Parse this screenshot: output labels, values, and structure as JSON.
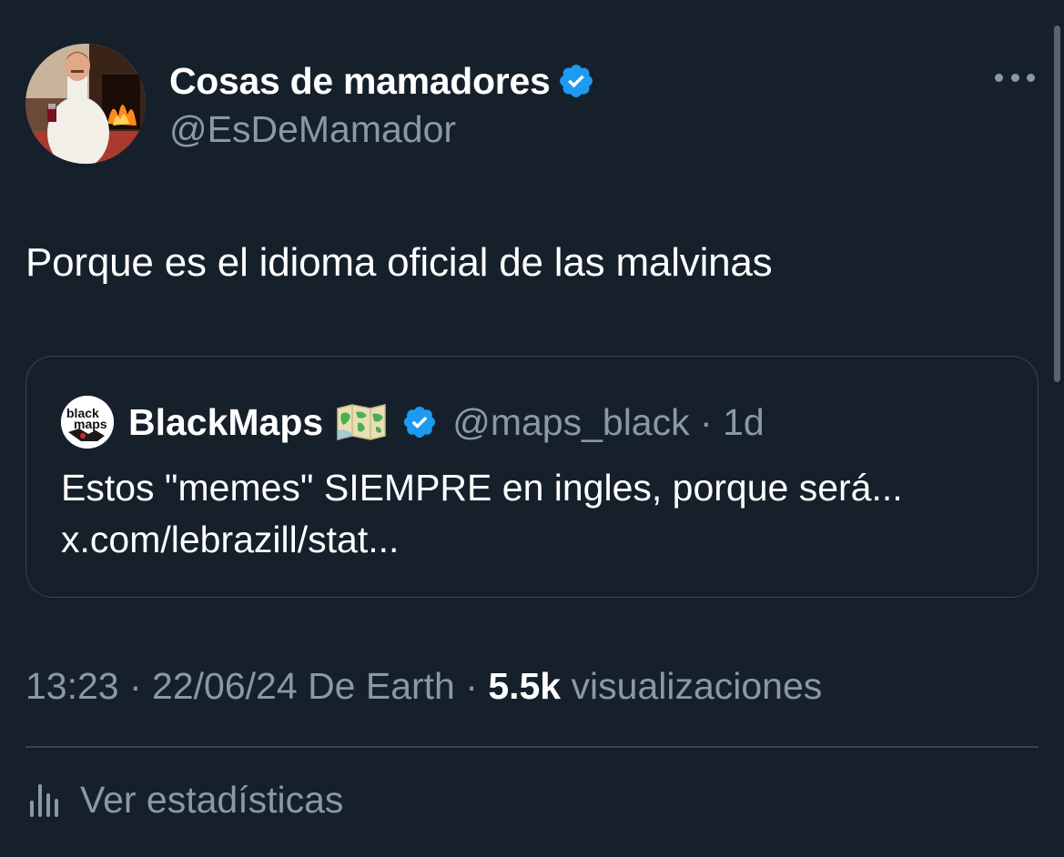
{
  "tweet": {
    "author": {
      "name": "Cosas de mamadores",
      "handle": "@EsDeMamador",
      "verified": true
    },
    "text": "Porque es el idioma oficial de las malvinas",
    "quoted": {
      "avatar_text_line1": "black",
      "avatar_text_line2": "maps",
      "name": "BlackMaps",
      "name_emoji": "world-map-icon",
      "verified": true,
      "handle": "@maps_black",
      "separator": " · ",
      "age": "1d",
      "text_line1": "Estos \"memes\" SIEMPRE en ingles, porque será...",
      "text_line2": "x.com/lebrazill/stat..."
    },
    "meta": {
      "time": "13:23",
      "date": "22/06/24",
      "location": "De Earth",
      "views_count": "5.5k",
      "views_label": "visualizaciones"
    },
    "stats_label": "Ver estadísticas"
  },
  "colors": {
    "background": "#15202b",
    "text_primary": "#ffffff",
    "text_secondary": "#8b98a5",
    "border": "#38444d",
    "verified_blue": "#1d9bf0"
  }
}
